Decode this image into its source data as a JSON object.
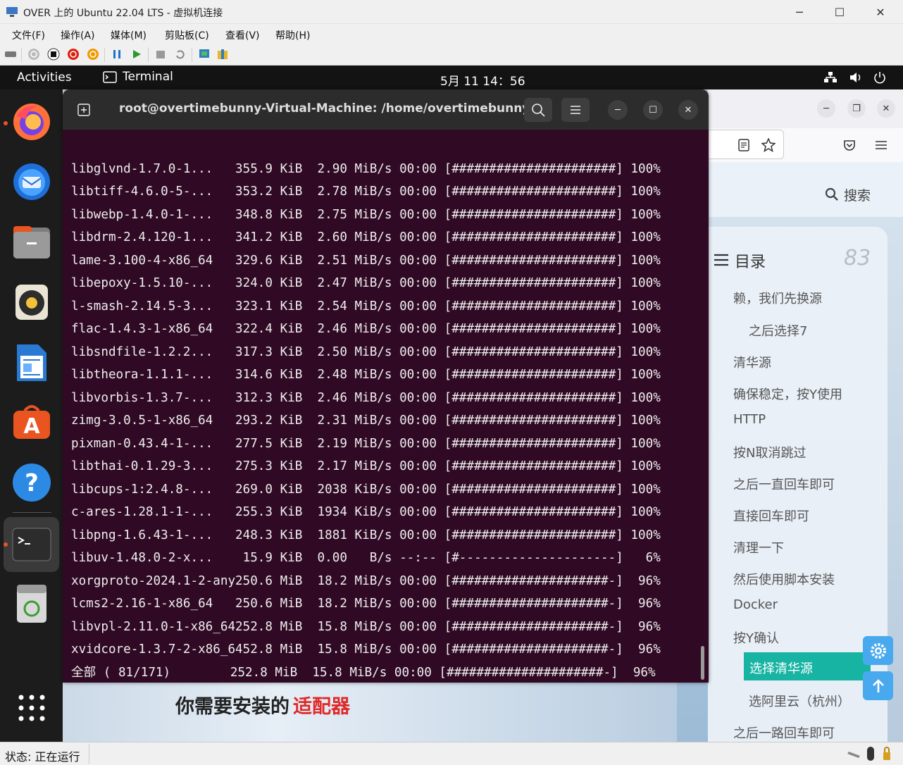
{
  "window": {
    "title": "OVER 上的 Ubuntu 22.04 LTS - 虚拟机连接"
  },
  "menu": [
    "文件(F)",
    "操作(A)",
    "媒体(M)",
    "剪贴板(C)",
    "查看(V)",
    "帮助(H)"
  ],
  "topbar": {
    "activities": "Activities",
    "app": "Terminal",
    "clock": "5月 11 14：56"
  },
  "terminal": {
    "title": "root@overtimebunny-Virtual-Machine: /home/overtimebunny",
    "lines": [
      "libglvnd-1.7.0-1...   355.9 KiB  2.90 MiB/s 00:00 [######################] 100%",
      "libtiff-4.6.0-5-...   353.2 KiB  2.78 MiB/s 00:00 [######################] 100%",
      "libwebp-1.4.0-1-...   348.8 KiB  2.75 MiB/s 00:00 [######################] 100%",
      "libdrm-2.4.120-1...   341.2 KiB  2.60 MiB/s 00:00 [######################] 100%",
      "lame-3.100-4-x86_64   329.6 KiB  2.51 MiB/s 00:00 [######################] 100%",
      "libepoxy-1.5.10-...   324.0 KiB  2.47 MiB/s 00:00 [######################] 100%",
      "l-smash-2.14.5-3...   323.1 KiB  2.54 MiB/s 00:00 [######################] 100%",
      "flac-1.4.3-1-x86_64   322.4 KiB  2.46 MiB/s 00:00 [######################] 100%",
      "libsndfile-1.2.2...   317.3 KiB  2.50 MiB/s 00:00 [######################] 100%",
      "libtheora-1.1.1-...   314.6 KiB  2.48 MiB/s 00:00 [######################] 100%",
      "libvorbis-1.3.7-...   312.3 KiB  2.46 MiB/s 00:00 [######################] 100%",
      "zimg-3.0.5-1-x86_64   293.2 KiB  2.31 MiB/s 00:00 [######################] 100%",
      "pixman-0.43.4-1-...   277.5 KiB  2.19 MiB/s 00:00 [######################] 100%",
      "libthai-0.1.29-3...   275.3 KiB  2.17 MiB/s 00:00 [######################] 100%",
      "libcups-1:2.4.8-...   269.0 KiB  2038 KiB/s 00:00 [######################] 100%",
      "c-ares-1.28.1-1-...   255.3 KiB  1934 KiB/s 00:00 [######################] 100%",
      "libpng-1.6.43-1-...   248.3 KiB  1881 KiB/s 00:00 [######################] 100%",
      "libuv-1.48.0-2-x...    15.9 KiB  0.00   B/s --:-- [#---------------------]   6%",
      "xorgproto-2024.1-2-any250.6 MiB  18.2 MiB/s 00:00 [#####################-]  96%",
      "lcms2-2.16-1-x86_64   250.6 MiB  18.2 MiB/s 00:00 [#####################-]  96%",
      "libvpl-2.11.0-1-x86_64252.8 MiB  15.8 MiB/s 00:00 [#####################-]  96%",
      "xvidcore-1.3.7-2-x86_6452.8 MiB  15.8 MiB/s 00:00 [#####################-]  96%",
      "全部 ( 81/171)        252.8 MiB  15.8 MiB/s 00:00 [#####################-]  96%"
    ]
  },
  "firefox": {
    "search": "搜索",
    "toc_title": "目录",
    "toc_count": "83",
    "toc": [
      "赖，我们先换源",
      "之后选择7",
      "清华源",
      "确保稳定，按Y使用",
      "HTTP",
      "按N取消跳过",
      "之后一直回车即可",
      "直接回车即可",
      "清理一下",
      "然后使用脚本安装",
      "Docker",
      "按Y确认",
      "选择清华源",
      "选阿里云（杭州）",
      "之后一路回车即可"
    ]
  },
  "banner": {
    "text_a": "你需要安装的",
    "text_b": "适配器"
  },
  "status": {
    "label": "状态: 正在运行"
  }
}
